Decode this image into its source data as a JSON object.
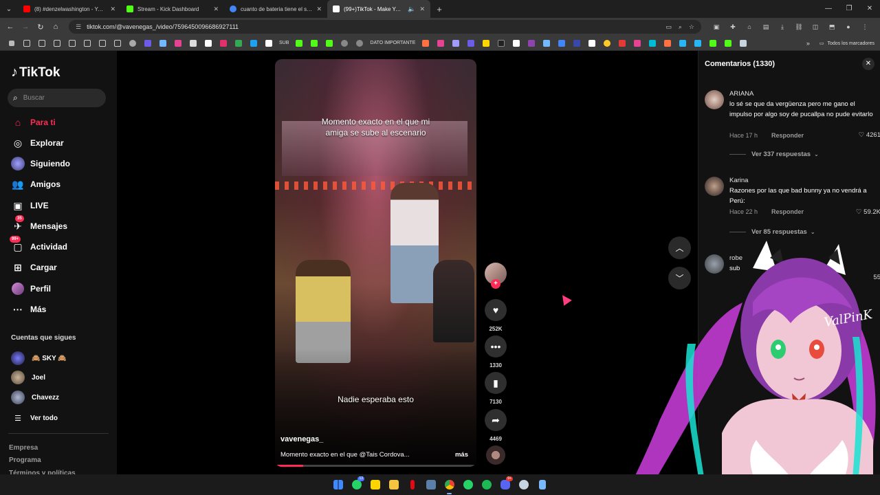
{
  "browser": {
    "tabs": [
      {
        "title": "(8) #denzelwashington - YouTube",
        "color": "#ff0000",
        "active": false
      },
      {
        "title": "Stream - Kick Dashboard",
        "color": "#53fc18",
        "active": false
      },
      {
        "title": "cuanto de bateria tiene el samsung",
        "color": "#4285f4",
        "active": false
      },
      {
        "title": "(99+)TikTok - Make Your Day",
        "color": "#ffffff",
        "active": true
      }
    ],
    "url": "tiktok.com/@vavenegas_/video/7596450096686927111",
    "bookmark_folder_label": "SUB",
    "bookmark_text": "DATO IMPORTANTE",
    "all_bookmarks": "Todos los marcadores"
  },
  "sidebar": {
    "logo": "TikTok",
    "search_placeholder": "Buscar",
    "nav": [
      {
        "label": "Para ti",
        "icon": "home-icon",
        "active": true
      },
      {
        "label": "Explorar",
        "icon": "compass-icon"
      },
      {
        "label": "Siguiendo",
        "icon": "following-icon"
      },
      {
        "label": "Amigos",
        "icon": "friends-icon"
      },
      {
        "label": "LIVE",
        "icon": "live-icon"
      },
      {
        "label": "Mensajes",
        "icon": "messages-icon",
        "badge": "35"
      },
      {
        "label": "Actividad",
        "icon": "activity-icon",
        "badge": "99+"
      },
      {
        "label": "Cargar",
        "icon": "upload-icon"
      },
      {
        "label": "Perfil",
        "icon": "profile-icon"
      },
      {
        "label": "Más",
        "icon": "more-icon"
      }
    ],
    "following_title": "Cuentas que sigues",
    "following": [
      {
        "name": "🙈 SKY 🙈"
      },
      {
        "name": "Joel"
      },
      {
        "name": "Chavezz"
      }
    ],
    "see_all": "Ver todo",
    "footer": [
      "Empresa",
      "Programa",
      "Términos y políticas"
    ]
  },
  "video": {
    "caption_top": "Momento exacto en el que mi amiga se sube al escenario",
    "caption_bottom": "Nadie esperaba esto",
    "username": "vavenegas_",
    "description": "Momento exacto en el que @Tais Cordova...",
    "more": "más",
    "progress": 0.14
  },
  "actions": {
    "likes": "252K",
    "comments": "1330",
    "saves": "7130",
    "shares": "4469"
  },
  "comments_panel": {
    "title": "Comentarios (1330)",
    "items": [
      {
        "user": "ARIANA",
        "text": "lo sé se que da vergüenza pero me gano el impulso por algo soy de pucallpa no pude evitarlo",
        "time": "Hace 17 h",
        "reply": "Responder",
        "likes": "4261",
        "replies": "Ver 337 respuestas"
      },
      {
        "user": "Karina",
        "text": "Razones por las que bad bunny ya no vendrá a Perú:",
        "time": "Hace 22 h",
        "reply": "Responder",
        "likes": "59.2K",
        "replies": "Ver 85 respuestas"
      },
      {
        "user": "robe",
        "text": "sub",
        "likes": "55"
      }
    ]
  },
  "overlay": {
    "watermark": "ValPinK"
  },
  "taskbar": {
    "apps": [
      {
        "icon": "windows-start-icon",
        "color": "#3d8bff"
      },
      {
        "icon": "whatsapp-icon",
        "color": "#25d366",
        "badge": "13"
      },
      {
        "icon": "sticky-notes-icon",
        "color": "#ffd500"
      },
      {
        "icon": "file-explorer-icon",
        "color": "#f5c542"
      },
      {
        "icon": "netflix-icon",
        "color": "#e50914"
      },
      {
        "icon": "app-icon",
        "color": "#5a7fa8"
      },
      {
        "icon": "chrome-icon",
        "color": "#4285f4",
        "active": true
      },
      {
        "icon": "whatsapp-desktop-icon",
        "color": "#25d366"
      },
      {
        "icon": "spotify-icon",
        "color": "#1db954"
      },
      {
        "icon": "discord-icon",
        "color": "#5865f2",
        "badge": "9+"
      },
      {
        "icon": "steam-icon",
        "color": "#c7d5e0"
      },
      {
        "icon": "notepad-icon",
        "color": "#7ab8ff"
      }
    ]
  }
}
